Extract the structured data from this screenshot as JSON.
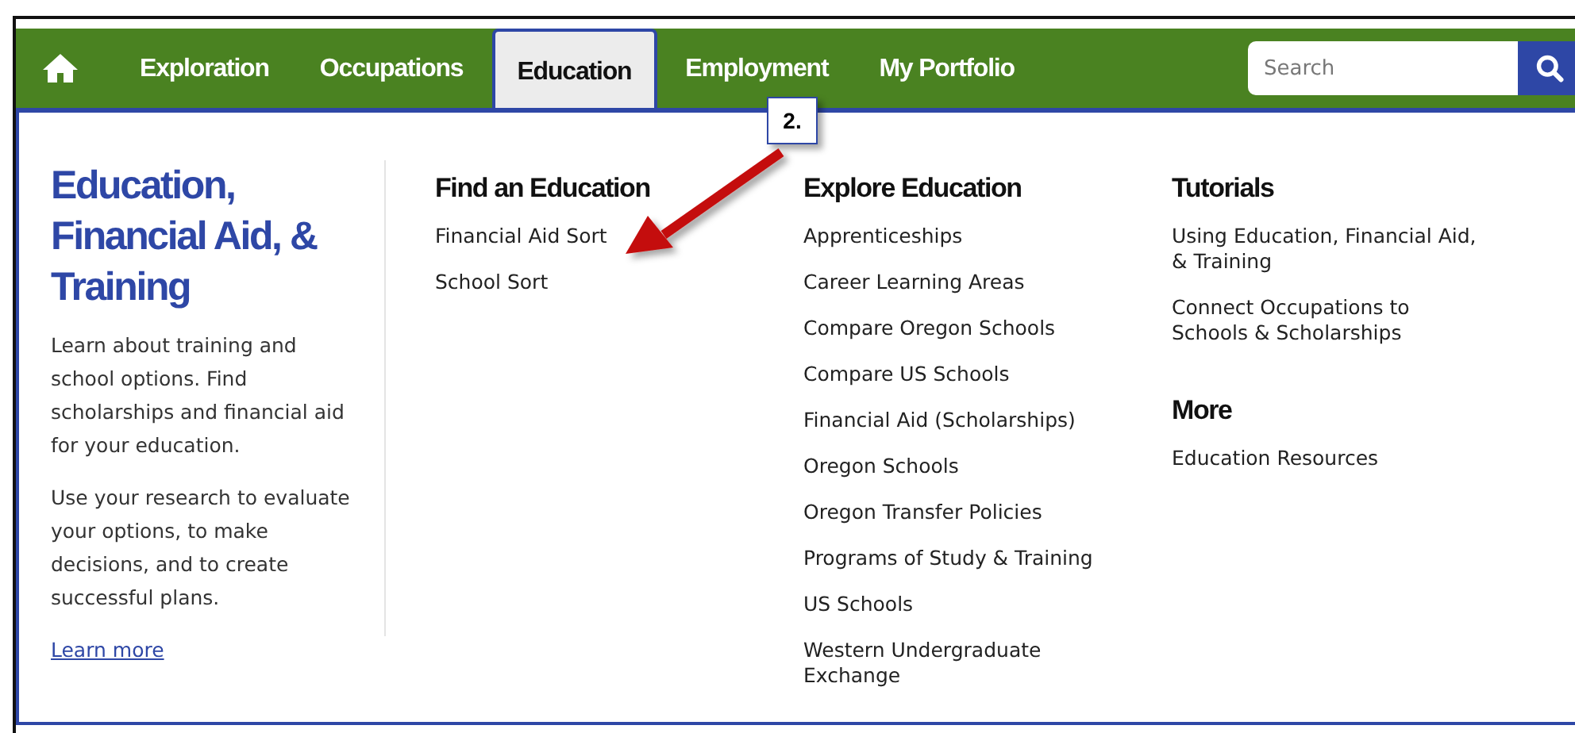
{
  "nav": {
    "tabs": [
      {
        "label": "Exploration",
        "selected": false
      },
      {
        "label": "Occupations",
        "selected": false
      },
      {
        "label": "Education",
        "selected": true
      },
      {
        "label": "Employment",
        "selected": false
      },
      {
        "label": "My Portfolio",
        "selected": false
      }
    ],
    "search": {
      "placeholder": "Search"
    }
  },
  "intro": {
    "title": "Education, Financial Aid, & Training",
    "paragraphs": [
      "Learn about training and school options. Find scholarships and financial aid for your education.",
      "Use your research to evaluate your options, to make decisions, and to create successful plans."
    ],
    "link": "Learn more"
  },
  "columns": [
    {
      "sections": [
        {
          "heading": "Find an Education",
          "links": [
            "Financial Aid Sort",
            "School Sort"
          ]
        }
      ]
    },
    {
      "sections": [
        {
          "heading": "Explore Education",
          "links": [
            "Apprenticeships",
            "Career Learning Areas",
            "Compare Oregon Schools",
            "Compare US Schools",
            "Financial Aid (Scholarships)",
            "Oregon Schools",
            "Oregon Transfer Policies",
            "Programs of Study & Training",
            "US Schools",
            "Western Undergraduate Exchange"
          ]
        }
      ]
    },
    {
      "sections": [
        {
          "heading": "Tutorials",
          "links": [
            "Using Education, Financial Aid, & Training",
            "Connect Occupations to Schools & Scholarships"
          ]
        },
        {
          "heading": "More",
          "links": [
            "Education Resources"
          ]
        }
      ]
    }
  ],
  "callout": {
    "label": "2."
  }
}
